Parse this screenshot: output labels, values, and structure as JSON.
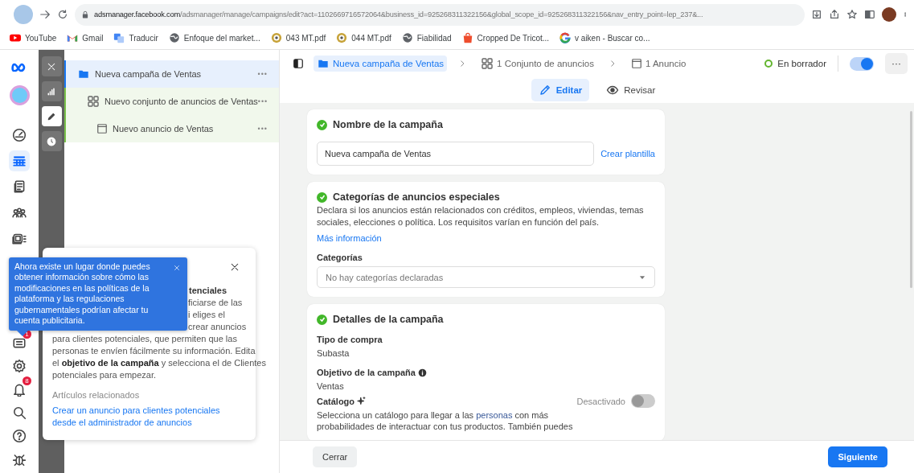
{
  "browser": {
    "url_host": "adsmanager.facebook.com",
    "url_path": "/adsmanager/manage/campaigns/edit?act=1102669716572064&business_id=925268311322156&global_scope_id=925268311322156&nav_entry_point=lep_237&...",
    "bookmarks": [
      {
        "kind": "youtube",
        "label": "YouTube"
      },
      {
        "kind": "gmail",
        "label": "Gmail"
      },
      {
        "kind": "translate",
        "label": "Traducir"
      },
      {
        "kind": "globe",
        "label": "Enfoque del market..."
      },
      {
        "kind": "pdf",
        "label": "043 MT.pdf"
      },
      {
        "kind": "pdf",
        "label": "044 MT.pdf"
      },
      {
        "kind": "globe",
        "label": "Fiabilidad"
      },
      {
        "kind": "bag",
        "label": "Cropped De Tricot..."
      },
      {
        "kind": "google",
        "label": "v aiken - Buscar co..."
      }
    ]
  },
  "rail": {
    "top_items": [
      {
        "kind": "gauge",
        "selected": false
      },
      {
        "kind": "table",
        "selected": true
      },
      {
        "kind": "pages",
        "selected": false
      },
      {
        "kind": "people",
        "selected": false
      },
      {
        "kind": "media",
        "selected": false
      }
    ],
    "bottom_items": [
      {
        "kind": "news",
        "selected": false,
        "badge": "1"
      },
      {
        "kind": "gear",
        "selected": false
      },
      {
        "kind": "bell",
        "selected": false,
        "badge": "8"
      },
      {
        "kind": "search",
        "selected": false
      },
      {
        "kind": "help",
        "selected": false
      },
      {
        "kind": "bug",
        "selected": false
      }
    ]
  },
  "tools": [
    {
      "kind": "close",
      "selected": false
    },
    {
      "kind": "chart",
      "selected": false
    },
    {
      "kind": "edit",
      "selected": true
    },
    {
      "kind": "history",
      "selected": false
    }
  ],
  "tree": [
    {
      "kind": "campaign",
      "label": "Nueva campaña de Ventas",
      "more": "•••",
      "selected": true,
      "children": [
        {
          "kind": "adset",
          "label": "Nuevo conjunto de anuncios de Ventas",
          "more": "•••",
          "selected": false,
          "children": [
            {
              "kind": "ad",
              "label": "Nuevo anuncio de Ventas",
              "more": "•••",
              "selected": false
            }
          ]
        }
      ]
    }
  ],
  "breadcrumb": [
    {
      "kind": "campaign",
      "label": "Nueva campaña de Ventas",
      "selected": true
    },
    {
      "kind": "adset",
      "label": "1 Conjunto de anuncios",
      "selected": false
    },
    {
      "kind": "ad",
      "label": "1 Anuncio",
      "selected": false
    }
  ],
  "status": {
    "label": "En borrador",
    "color": "#63b52f",
    "on": true,
    "more": "···"
  },
  "tabs": [
    {
      "kind": "edit",
      "label": "Editar",
      "selected": true
    },
    {
      "kind": "review",
      "label": "Revisar",
      "selected": false
    }
  ],
  "cards": [
    {
      "kind": "name",
      "title": "Nombre de la campaña",
      "complete": true,
      "value": "Nueva campaña de Ventas",
      "link": "Crear plantilla"
    },
    {
      "kind": "categories",
      "title": "Categorías de anuncios especiales",
      "complete": true,
      "description": "Declara si los anuncios están relacionados con créditos, empleos, viviendas, temas sociales, elecciones o política. Los requisitos varían en función del país.",
      "link": "Más información",
      "field_label": "Categorías",
      "placeholder": "No hay categorías declaradas"
    },
    {
      "kind": "details",
      "title": "Detalles de la campaña",
      "complete": true,
      "fields": [
        {
          "label": "Tipo de compra",
          "value": "Subasta",
          "info": false
        },
        {
          "label": "Objetivo de la campaña",
          "value": "Ventas",
          "info": true
        }
      ],
      "catalog": {
        "label": "Catálogo",
        "state_label": "Desactivado",
        "on": false,
        "text_before": "Selecciona un catálogo para llegar a las ",
        "link": "personas",
        "text_after": " con más probabilidades de interactuar con tus productos. También puedes"
      }
    }
  ],
  "footer": {
    "close": "Cerrar",
    "next": "Siguiente"
  },
  "popover": {
    "covered_lines": [
      {
        "kind": "heading",
        "text": "tenciales"
      },
      {
        "kind": "body",
        "text": "ficiarse de las"
      },
      {
        "kind": "body",
        "text": "i eliges el"
      },
      {
        "kind": "body",
        "text": "crear anuncios"
      }
    ],
    "lines": [
      "para clientes potenciales, que permiten que las",
      "personas te envíen fácilmente su información. Edita",
      "el **objetivo de la campaña** y selecciona el de Clientes",
      "potenciales para empezar."
    ],
    "related_label": "Artículos relacionados",
    "related_link": "Crear un anuncio para clientes potenciales desde el administrador de anuncios"
  },
  "tooltip": {
    "text": "Ahora existe un lugar donde puedes obtener información sobre cómo las modificaciones en las políticas de la plataforma y las regulaciones gubernamentales podrían afectar tu cuenta publicitaria."
  }
}
